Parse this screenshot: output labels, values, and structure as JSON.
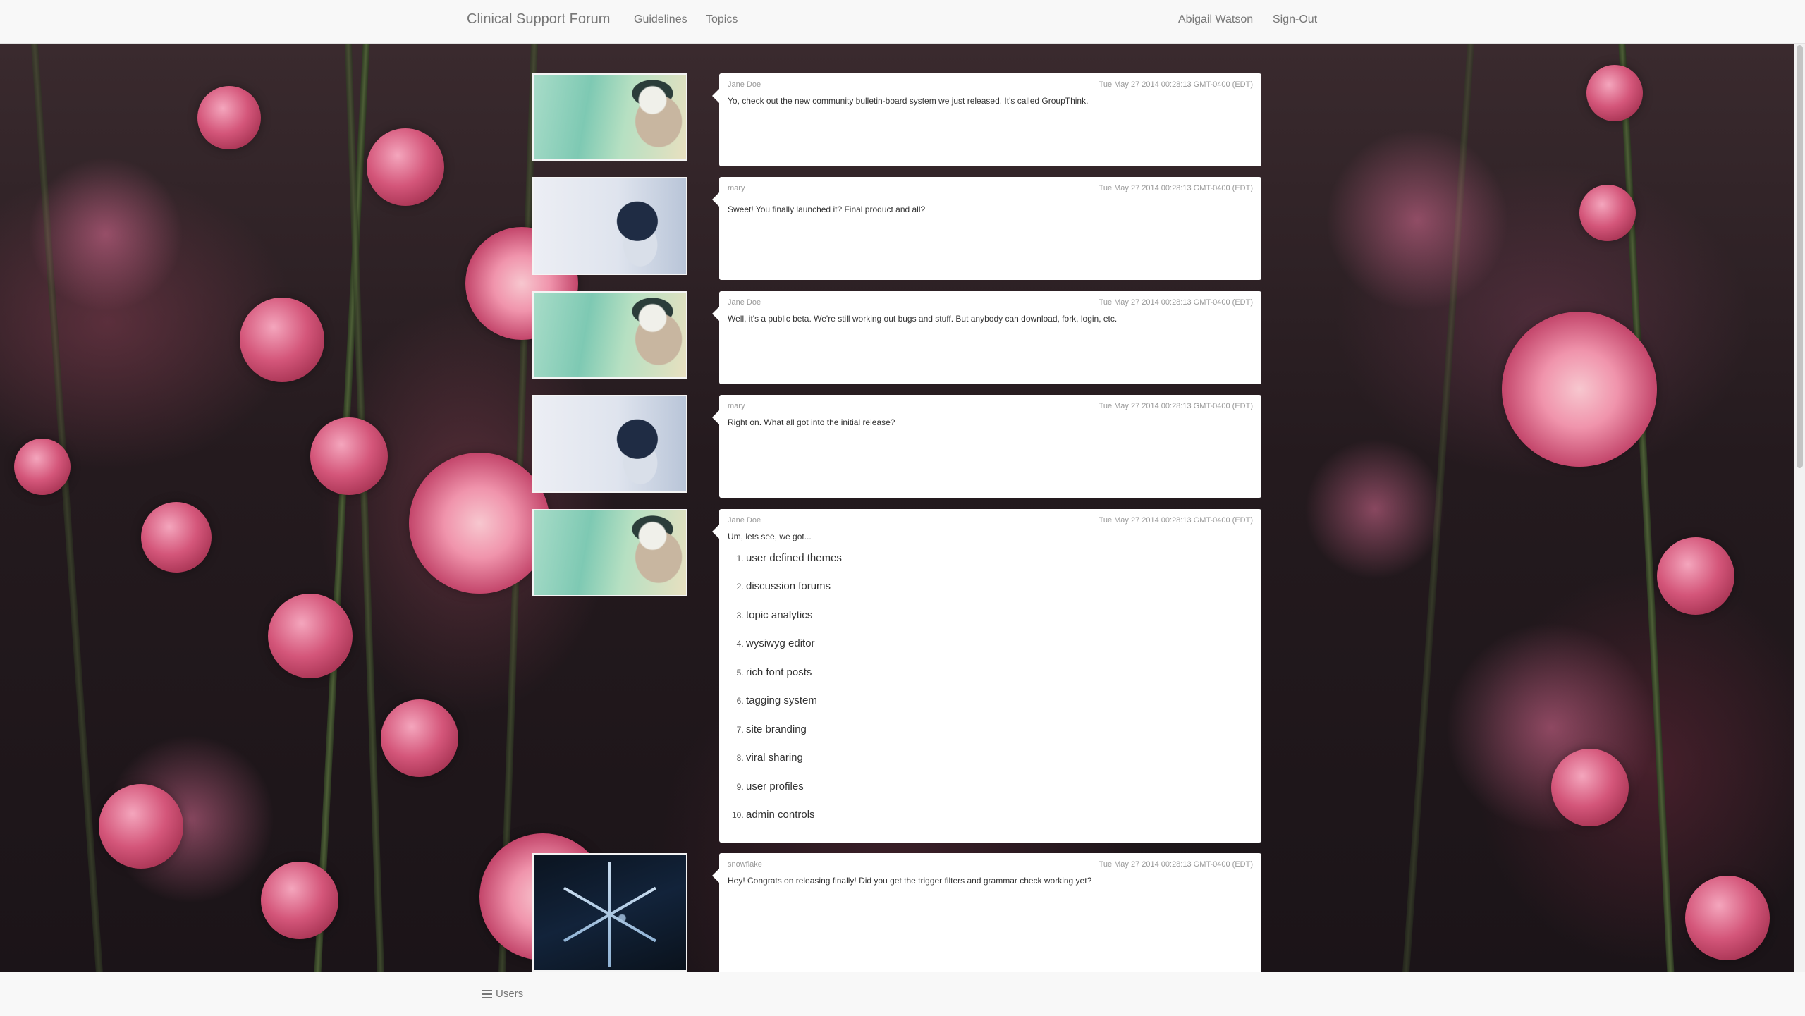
{
  "navbar": {
    "brand": "Clinical Support Forum",
    "links": [
      "Guidelines",
      "Topics"
    ],
    "user": "Abigail Watson",
    "signout": "Sign-Out"
  },
  "posts": [
    {
      "author": "Jane Doe",
      "timestamp": "Tue May 27 2014 00:28:13 GMT-0400 (EDT)",
      "message": "Yo, check out the new community bulletin-board system we just released.  It's called GroupThink."
    },
    {
      "author": "mary",
      "timestamp": "Tue May 27 2014 00:28:13 GMT-0400 (EDT)",
      "message": "Sweet!  You finally launched it?  Final product and all?"
    },
    {
      "author": "Jane Doe",
      "timestamp": "Tue May 27 2014 00:28:13 GMT-0400 (EDT)",
      "message": "Well, it's a public beta.  We're still working out bugs and stuff.  But anybody can download, fork, login, etc."
    },
    {
      "author": "mary",
      "timestamp": "Tue May 27 2014 00:28:13 GMT-0400 (EDT)",
      "message": "Right on.  What all got into the initial release?"
    },
    {
      "author": "Jane Doe",
      "timestamp": "Tue May 27 2014 00:28:13 GMT-0400 (EDT)",
      "message": "Um, lets see, we got...",
      "list": [
        "user defined themes",
        "discussion forums",
        "topic analytics",
        "wysiwyg editor",
        "rich font posts",
        "tagging system",
        "site branding",
        "viral sharing",
        "user profiles",
        "admin controls"
      ]
    },
    {
      "author": "snowflake",
      "timestamp": "Tue May 27 2014 00:28:13 GMT-0400 (EDT)",
      "message": "Hey!  Congrats on releasing finally!  Did you get the trigger filters and grammar check working yet?"
    }
  ],
  "footer": {
    "users_label": "Users",
    "users_icon": "list-icon"
  },
  "colors": {
    "navbar_bg": "#f8f8f8",
    "nav_text": "#777777",
    "bubble_bg": "#ffffff",
    "meta_text": "#999999"
  }
}
